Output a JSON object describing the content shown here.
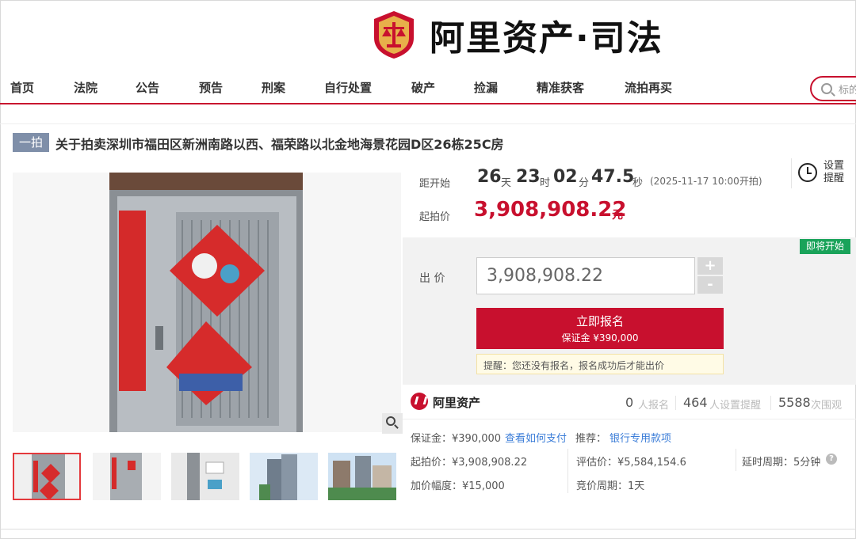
{
  "brand": {
    "name": "阿里资产·司法",
    "colors": {
      "accent": "#c8102e",
      "tag": "#7f8fa9",
      "badge": "#1aa35a"
    }
  },
  "nav": {
    "items": [
      "首页",
      "法院",
      "公告",
      "预告",
      "刑案",
      "自行处置",
      "破产",
      "捡漏",
      "精准获客",
      "流拍再买"
    ],
    "search_placeholder": "标的"
  },
  "listing": {
    "tag": "一拍",
    "title": "关于拍卖深圳市福田区新洲南路以西、福荣路以北金地海景花园D区26栋25C房"
  },
  "countdown": {
    "label": "距开始",
    "days": "26",
    "days_unit": "天",
    "hours": "23",
    "hours_unit": "时",
    "minutes": "02",
    "minutes_unit": "分",
    "seconds": "47.5",
    "seconds_unit": "秒",
    "start_note": "(2025-11-17 10:00开拍)"
  },
  "reminder": {
    "label": "设置提醒",
    "icon": "alarm-clock-icon"
  },
  "price": {
    "label": "起拍价",
    "value": "3,908,908.22",
    "unit": "元"
  },
  "bid": {
    "status_badge": "即将开始",
    "label": "出 价",
    "value": "3,908,908.22",
    "plus": "+",
    "minus": "-",
    "signup_main": "立即报名",
    "signup_sub": "保证金 ¥390,000",
    "tip": "提醒：您还没有报名，报名成功后才能出价"
  },
  "stats": {
    "platform": "阿里资产",
    "signups": "0",
    "signups_label": "人报名",
    "reminders": "464",
    "reminders_label": "人设置提醒",
    "views": "5588",
    "views_label": "次围观"
  },
  "details": {
    "deposit": "保证金：¥390,000",
    "how_to_pay": "查看如何支付",
    "recommend_label": "推荐：",
    "recommend_link": "银行专用款项",
    "start_price": "起拍价：¥3,908,908.22",
    "appraisal": "评估价：¥5,584,154.6",
    "delay": "延时周期：5分钟",
    "increment": "加价幅度：¥15,000",
    "bid_period": "竞价周期：1天"
  },
  "gallery": {
    "thumb_count": 5,
    "active_index": 0
  }
}
